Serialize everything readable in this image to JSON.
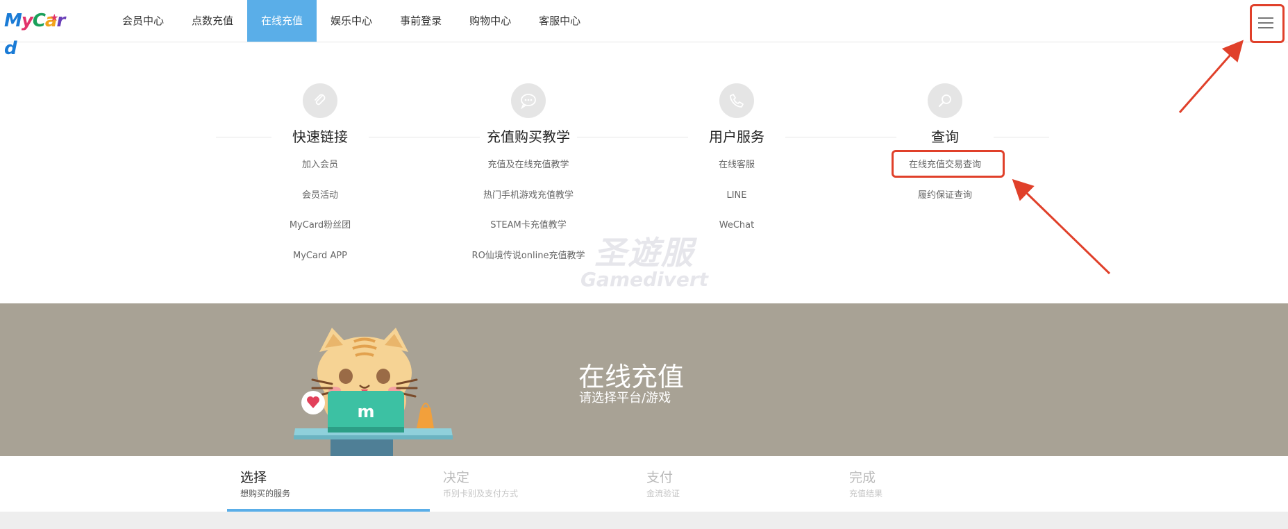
{
  "header": {
    "logo_text": "MyCard",
    "nav": [
      {
        "label": "会员中心",
        "active": false
      },
      {
        "label": "点数充值",
        "active": false
      },
      {
        "label": "在线充值",
        "active": true
      },
      {
        "label": "娱乐中心",
        "active": false
      },
      {
        "label": "事前登录",
        "active": false
      },
      {
        "label": "购物中心",
        "active": false
      },
      {
        "label": "客服中心",
        "active": false
      }
    ],
    "menu_icon": "hamburger-menu-icon"
  },
  "quick_links": [
    {
      "title": "快速链接",
      "icon": "link-icon",
      "items": [
        "加入会员",
        "会员活动",
        "MyCard粉丝团",
        "MyCard APP"
      ]
    },
    {
      "title": "充值购买教学",
      "icon": "chat-bubble-icon",
      "items": [
        "充值及在线充值教学",
        "热门手机游戏充值教学",
        "STEAM卡充值教学",
        "RO仙境传说online充值教学"
      ]
    },
    {
      "title": "用户服务",
      "icon": "phone-icon",
      "items": [
        "在线客服",
        "LINE",
        "WeChat"
      ]
    },
    {
      "title": "查询",
      "icon": "search-icon",
      "items": [
        "在线充值交易查询",
        "履约保证查询"
      ]
    }
  ],
  "watermark": {
    "line1": "圣遊服",
    "line2": "Gamedivert"
  },
  "banner": {
    "title": "在线充值",
    "subtitle": "请选择平台/游戏",
    "laptop_logo": "m"
  },
  "steps": [
    {
      "title": "选择",
      "subtitle": "想购买的服务",
      "active": true
    },
    {
      "title": "决定",
      "subtitle": "币别卡别及支付方式",
      "active": false
    },
    {
      "title": "支付",
      "subtitle": "金流验证",
      "active": false
    },
    {
      "title": "完成",
      "subtitle": "充值结果",
      "active": false
    }
  ],
  "colors": {
    "accent": "#5aaee8",
    "banner_bg": "#a8a295",
    "annotation": "#e0402a"
  }
}
